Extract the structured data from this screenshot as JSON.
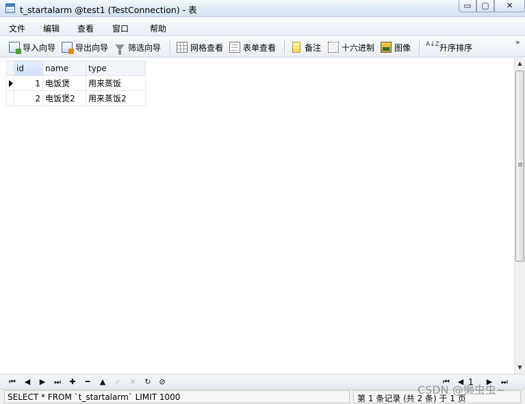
{
  "window": {
    "title": "t_startalarm @test1 (TestConnection) - 表",
    "controls": {
      "minimize": "▭",
      "maximize": "▢",
      "close": "✕"
    }
  },
  "menubar": {
    "items": [
      "文件",
      "编辑",
      "查看",
      "窗口",
      "帮助"
    ]
  },
  "toolbar": {
    "import_wizard": "导入向导",
    "export_wizard": "导出向导",
    "filter_wizard": "筛选向导",
    "grid_view": "网格查看",
    "form_view": "表单查看",
    "memo": "备注",
    "hex": "十六进制",
    "image": "图像",
    "sort_ascending": "升序排序",
    "sort_icon_glyph": "A↓Z",
    "overflow": "»"
  },
  "table": {
    "columns": [
      "id",
      "name",
      "type"
    ],
    "selected_column": "id",
    "current_row": 0,
    "rows": [
      {
        "id": "1",
        "name": "电饭煲",
        "type": "用来蒸饭"
      },
      {
        "id": "2",
        "name": "电饭煲2",
        "type": "用来蒸饭2"
      }
    ]
  },
  "scrollbar": {
    "up": "▲",
    "down": "▼"
  },
  "navigator": {
    "first": "⏮",
    "prev": "◀",
    "next": "▶",
    "last": "⏭",
    "add": "✚",
    "delete": "━",
    "up": "▲",
    "apply": "✓",
    "cancel": "✕",
    "refresh": "↻",
    "stop": "⊘",
    "page_first": "⏮",
    "page_prev": "◀",
    "page_number": "1",
    "page_next": "▶",
    "page_last": "⏭"
  },
  "status": {
    "sql": "SELECT * FROM `t_startalarm` LIMIT 1000",
    "records": "第 1 条记录 (共 2 条) 于 1 页"
  },
  "watermark": "CSDN @懒虫虫~"
}
